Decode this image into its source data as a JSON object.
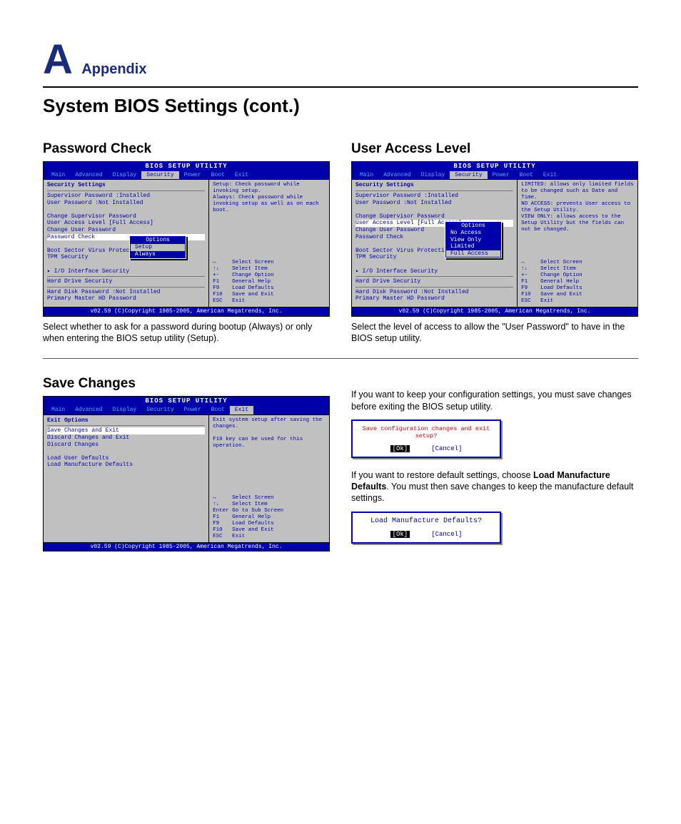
{
  "header": {
    "letter": "A",
    "label": "Appendix"
  },
  "page_title": "System BIOS Settings (cont.)",
  "bios_common": {
    "title": "BIOS SETUP UTILITY",
    "menu": [
      "Main",
      "Advanced",
      "Display",
      "Security",
      "Power",
      "Boot",
      "Exit"
    ],
    "footer": "v02.59 (C)Copyright 1985-2005, American Megatrends, Inc.",
    "nav": [
      [
        "↔",
        "Select Screen"
      ],
      [
        "↑↓",
        "Select Item"
      ],
      [
        "+-",
        "Change Option"
      ],
      [
        "F1",
        "General Help"
      ],
      [
        "F9",
        "Load Defaults"
      ],
      [
        "F10",
        "Save and Exit"
      ],
      [
        "ESC",
        "Exit"
      ]
    ],
    "nav_exit": [
      [
        "↔",
        "Select Screen"
      ],
      [
        "↑↓",
        "Select Item"
      ],
      [
        "Enter",
        "Go to Sub Screen"
      ],
      [
        "F1",
        "General Help"
      ],
      [
        "F9",
        "Load Defaults"
      ],
      [
        "F10",
        "Save and Exit"
      ],
      [
        "ESC",
        "Exit"
      ]
    ]
  },
  "section1": {
    "title": "Password Check",
    "caption": "Select whether to ask for a password during bootup (Always) or only when entering the BIOS setup utility (Setup).",
    "panel": {
      "active_tab": "Security",
      "heading": "Security Settings",
      "rows": [
        "Supervisor Password  :Installed",
        "User Password        :Not Installed",
        "",
        "Change Supervisor Password",
        "User Access Level          [Full Access]",
        "Change User Password",
        "Password Check",
        "",
        "Boot Sector Virus Protectio",
        "TPM Security",
        "",
        "▸ I/O Interface Security",
        "─────────────────────",
        "Hard Drive Security",
        "─────────────────────",
        "Hard Disk Password   :Not Installed",
        "Primary Master HD Password"
      ],
      "selected_row": "Password Check",
      "popup": {
        "title": "Options",
        "options": [
          "Setup",
          "Always"
        ],
        "selected": "Setup"
      },
      "help": "Setup: Check password while invoking setup.\nAlways: Check password while invoking setup as well as on each boot."
    }
  },
  "section2": {
    "title": "User Access Level",
    "caption": "Select the level of access to allow the \"User Password\" to have in the BIOS setup utility.",
    "panel": {
      "active_tab": "Security",
      "heading": "Security Settings",
      "rows": [
        "Supervisor Password  :Installed",
        "User Password        :Not Installed",
        "",
        "Change Supervisor Password",
        "User Access Level          [Full Access]",
        "Change User Password",
        "Password Check",
        "",
        "Boot Sector Virus Protectio",
        "TPM Security",
        "",
        "▸ I/O Interface Security",
        "─────────────────────",
        "Hard Drive Security",
        "─────────────────────",
        "Hard Disk Password   :Not Installed",
        "Primary Master HD Password"
      ],
      "selected_row": "User Access Level          [Full Access]",
      "popup": {
        "title": "Options",
        "options": [
          "No Access",
          "View Only",
          "Limited",
          "Full Access"
        ],
        "selected": "Full Access"
      },
      "help": "LIMITED: allows only limited fields to be changed such as Date and Time.\nNO ACCESS: prevents User access to the Setup Utility.\nVIEW ONLY: allows access to the Setup Utility but the fields can not be changed."
    }
  },
  "section3": {
    "title": "Save Changes",
    "text1": "If you want to keep your configuration settings, you must save changes before exiting the BIOS setup utility.",
    "text2a": "If you want to restore default settings, choose ",
    "text2b": "Load Manufacture Defaults",
    "text2c": ". You must then save changes to keep the manufacture default settings.",
    "panel": {
      "active_tab": "Exit",
      "heading": "Exit Options",
      "rows": [
        "Save Changes and Exit",
        "Discard Changes and Exit",
        "Discard Changes",
        "",
        "Load User Defaults",
        "Load Manufacture Defaults"
      ],
      "selected_row": "Save Changes and Exit",
      "help": "Exit system setup after saving the changes.\n\nF10 key can be used for this operation."
    },
    "dialog1": {
      "msg": "Save configuration changes and exit setup?",
      "ok": "[Ok]",
      "cancel": "[Cancel]"
    },
    "dialog2": {
      "msg": "Load Manufacture Defaults?",
      "ok": "[Ok]",
      "cancel": "[Cancel]"
    }
  }
}
